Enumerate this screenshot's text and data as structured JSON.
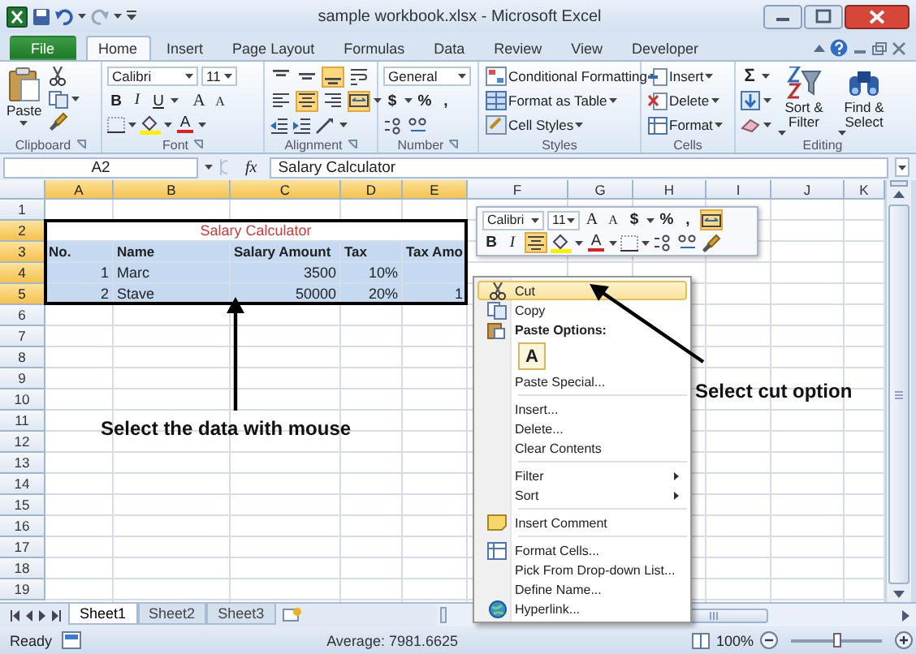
{
  "window": {
    "title": "sample workbook.xlsx - Microsoft Excel"
  },
  "ribbon_tabs": [
    {
      "label": "File",
      "kind": "file",
      "selected": false
    },
    {
      "label": "Home",
      "kind": "tab",
      "selected": true
    },
    {
      "label": "Insert",
      "kind": "tab",
      "selected": false
    },
    {
      "label": "Page Layout",
      "kind": "tab",
      "selected": false
    },
    {
      "label": "Formulas",
      "kind": "tab",
      "selected": false
    },
    {
      "label": "Data",
      "kind": "tab",
      "selected": false
    },
    {
      "label": "Review",
      "kind": "tab",
      "selected": false
    },
    {
      "label": "View",
      "kind": "tab",
      "selected": false
    },
    {
      "label": "Developer",
      "kind": "tab",
      "selected": false
    }
  ],
  "ribbon": {
    "clipboard": {
      "label": "Clipboard",
      "paste": "Paste"
    },
    "font": {
      "label": "Font",
      "font_name": "Calibri",
      "font_size": "11",
      "bold": "B",
      "italic": "I",
      "underline": "U",
      "grow": "A",
      "shrink": "A",
      "font_color": "A"
    },
    "alignment": {
      "label": "Alignment",
      "buttons": [
        {
          "selected": false
        },
        {
          "selected": false
        },
        {
          "selected": true
        },
        {
          "selected": false
        },
        {
          "selected": false
        },
        {
          "selected": true
        },
        {
          "selected": false
        },
        {
          "selected": true
        }
      ]
    },
    "number": {
      "label": "Number",
      "format": "General",
      "currency": "$",
      "percent": "%",
      "comma": ","
    },
    "styles": {
      "label": "Styles",
      "items": [
        "Conditional Formatting",
        "Format as Table",
        "Cell Styles"
      ]
    },
    "cells": {
      "label": "Cells",
      "items": [
        "Insert",
        "Delete",
        "Format"
      ]
    },
    "editing": {
      "label": "Editing",
      "sum": "Σ",
      "sort": "Sort & Filter",
      "find": "Find & Select"
    }
  },
  "formula_bar": {
    "name_box": "A2",
    "function_label": "fx",
    "content": "Salary Calculator"
  },
  "sheet": {
    "columns": [
      {
        "label": "A",
        "selected": true
      },
      {
        "label": "B",
        "selected": true
      },
      {
        "label": "C",
        "selected": true
      },
      {
        "label": "D",
        "selected": true
      },
      {
        "label": "E",
        "selected": true
      },
      {
        "label": "F",
        "selected": false
      },
      {
        "label": "G",
        "selected": false
      },
      {
        "label": "H",
        "selected": false
      },
      {
        "label": "I",
        "selected": false
      },
      {
        "label": "J",
        "selected": false
      },
      {
        "label": "K",
        "selected": false
      }
    ],
    "rows": [
      {
        "label": "1",
        "selected": false
      },
      {
        "label": "2",
        "selected": true,
        "cells": [
          {
            "text": "Salary Calculator",
            "kind": "title"
          }
        ]
      },
      {
        "label": "3",
        "selected": true,
        "cells": [
          {
            "text": "No.",
            "kind": "header"
          },
          {
            "text": "Name",
            "kind": "header"
          },
          {
            "text": "Salary Amount",
            "kind": "header"
          },
          {
            "text": "Tax",
            "kind": "header"
          },
          {
            "text": "Tax Amo",
            "kind": "header"
          }
        ]
      },
      {
        "label": "4",
        "selected": true,
        "cells": [
          {
            "text": "1",
            "kind": "number"
          },
          {
            "text": "Marc",
            "kind": "text"
          },
          {
            "text": "3500",
            "kind": "number"
          },
          {
            "text": "10%",
            "kind": "number"
          }
        ]
      },
      {
        "label": "5",
        "selected": true,
        "cells": [
          {
            "text": "2",
            "kind": "number"
          },
          {
            "text": "Stave",
            "kind": "text"
          },
          {
            "text": "50000",
            "kind": "number"
          },
          {
            "text": "20%",
            "kind": "number"
          },
          {
            "text": "1",
            "kind": "number"
          }
        ]
      },
      {
        "label": "6",
        "selected": false
      },
      {
        "label": "7",
        "selected": false
      },
      {
        "label": "8",
        "selected": false
      },
      {
        "label": "9",
        "selected": false
      },
      {
        "label": "10",
        "selected": false
      },
      {
        "label": "11",
        "selected": false
      },
      {
        "label": "12",
        "selected": false
      },
      {
        "label": "13",
        "selected": false
      },
      {
        "label": "14",
        "selected": false
      },
      {
        "label": "15",
        "selected": false
      },
      {
        "label": "16",
        "selected": false
      },
      {
        "label": "17",
        "selected": false
      },
      {
        "label": "18",
        "selected": false
      },
      {
        "label": "19",
        "selected": false
      }
    ]
  },
  "mini_toolbar": {
    "font_name": "Calibri",
    "font_size": "11",
    "grow": "A",
    "shrink": "A",
    "currency": "$",
    "percent": "%",
    "comma": ",",
    "bold": "B",
    "italic": "I",
    "font_color": "A",
    "merge_selected": true,
    "center_selected": true
  },
  "context_menu": [
    {
      "kind": "item",
      "label": "Cut",
      "selected": true,
      "submenu": false
    },
    {
      "kind": "item",
      "label": "Copy",
      "selected": false,
      "submenu": false
    },
    {
      "kind": "header",
      "label": "Paste Options:"
    },
    {
      "kind": "paste_button",
      "label": "A"
    },
    {
      "kind": "item",
      "label": "Paste Special...",
      "selected": false,
      "submenu": false
    },
    {
      "kind": "separator"
    },
    {
      "kind": "item",
      "label": "Insert...",
      "selected": false,
      "submenu": false
    },
    {
      "kind": "item",
      "label": "Delete...",
      "selected": false,
      "submenu": false
    },
    {
      "kind": "item",
      "label": "Clear Contents",
      "selected": false,
      "submenu": false
    },
    {
      "kind": "separator"
    },
    {
      "kind": "item",
      "label": "Filter",
      "selected": false,
      "submenu": true
    },
    {
      "kind": "item",
      "label": "Sort",
      "selected": false,
      "submenu": true
    },
    {
      "kind": "separator"
    },
    {
      "kind": "item",
      "label": "Insert Comment",
      "selected": false,
      "submenu": false
    },
    {
      "kind": "separator"
    },
    {
      "kind": "item",
      "label": "Format Cells...",
      "selected": false,
      "submenu": false
    },
    {
      "kind": "item",
      "label": "Pick From Drop-down List...",
      "selected": false,
      "submenu": false
    },
    {
      "kind": "item",
      "label": "Define Name...",
      "selected": false,
      "submenu": false
    },
    {
      "kind": "item",
      "label": "Hyperlink...",
      "selected": false,
      "submenu": false
    }
  ],
  "annotations": [
    {
      "text": "Select the data with mouse"
    },
    {
      "text": "Select cut option"
    }
  ],
  "sheet_tabs": [
    {
      "label": "Sheet1",
      "selected": true
    },
    {
      "label": "Sheet2",
      "selected": false
    },
    {
      "label": "Sheet3",
      "selected": false
    }
  ],
  "status_bar": {
    "status": "Ready",
    "summary": "Average: 7981.6625",
    "zoom": "100%",
    "zoom_slider": {
      "level": 0.5
    }
  }
}
